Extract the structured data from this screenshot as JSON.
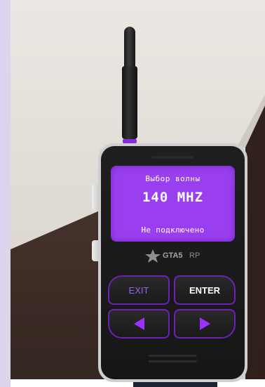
{
  "radio": {
    "screen": {
      "title": "Выбор волны",
      "frequency": "140 MHZ",
      "status": "Не подключено"
    },
    "logo": {
      "brand": "GTA5",
      "suffix": "RP"
    },
    "keys": {
      "exit_label": "EXIT",
      "enter_label": "ENTER",
      "left_icon": "left-arrow-icon",
      "right_icon": "right-arrow-icon"
    }
  },
  "colors": {
    "accent": "#9b30ff",
    "screen": "#9a3ff0",
    "body": "#1c1c1c",
    "frame": "#cfcfcf"
  }
}
